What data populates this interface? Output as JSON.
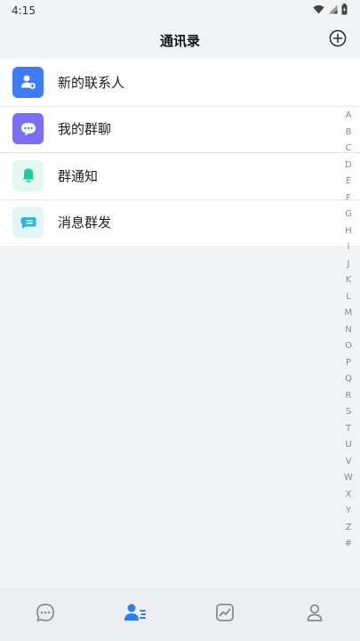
{
  "status_bar": {
    "time": "4:15",
    "icons": [
      "wifi-icon",
      "signal-icon",
      "battery-icon"
    ]
  },
  "header": {
    "title": "通讯录",
    "action_icon": "add-circle-icon"
  },
  "menu": [
    {
      "label": "新的联系人",
      "icon": "new-contact-icon",
      "color": "#3d7bf7"
    },
    {
      "label": "我的群聊",
      "icon": "group-chat-icon",
      "color": "#7a6ef5"
    },
    {
      "label": "群通知",
      "icon": "bell-icon",
      "color": "#1ec99b"
    },
    {
      "label": "消息群发",
      "icon": "broadcast-message-icon",
      "color": "#2bb8d6"
    }
  ],
  "alpha_index": [
    "A",
    "B",
    "C",
    "D",
    "E",
    "F",
    "G",
    "H",
    "I",
    "J",
    "K",
    "L",
    "M",
    "N",
    "O",
    "P",
    "Q",
    "R",
    "S",
    "T",
    "U",
    "V",
    "W",
    "X",
    "Y",
    "Z",
    "#"
  ],
  "tabbar": {
    "tabs": [
      {
        "icon": "chat-bubble-icon",
        "active": false
      },
      {
        "icon": "contacts-icon",
        "active": true
      },
      {
        "icon": "chart-icon",
        "active": false
      },
      {
        "icon": "profile-icon",
        "active": false
      }
    ],
    "active_color": "#2f7cf6",
    "inactive_color": "#8c8c8c"
  }
}
